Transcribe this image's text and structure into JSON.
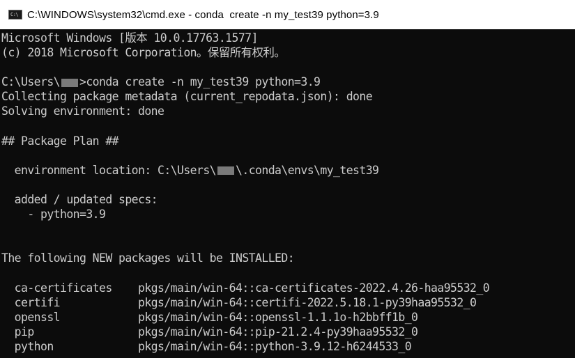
{
  "window": {
    "title": "C:\\WINDOWS\\system32\\cmd.exe - conda  create -n my_test39 python=3.9",
    "icon": "cmd-icon",
    "icon_glyph": "C:\\"
  },
  "console": {
    "lines": [
      "Microsoft Windows [版本 10.0.17763.1577]",
      "(c) 2018 Microsoft Corporation。保留所有权利。",
      "",
      {
        "before": "C:\\Users\\",
        "redacted": true,
        "after": ">conda create -n my_test39 python=3.9"
      },
      "Collecting package metadata (current_repodata.json): done",
      "Solving environment: done",
      "",
      "## Package Plan ##",
      "",
      {
        "before": "  environment location: C:\\Users\\",
        "redacted": true,
        "after": "\\.conda\\envs\\my_test39"
      },
      "",
      "  added / updated specs:",
      "    - python=3.9",
      "",
      "",
      "The following NEW packages will be INSTALLED:",
      "",
      "  ca-certificates    pkgs/main/win-64::ca-certificates-2022.4.26-haa95532_0",
      "  certifi            pkgs/main/win-64::certifi-2022.5.18.1-py39haa95532_0",
      "  openssl            pkgs/main/win-64::openssl-1.1.1o-h2bbff1b_0",
      "  pip                pkgs/main/win-64::pip-21.2.4-py39haa95532_0",
      "  python             pkgs/main/win-64::python-3.9.12-h6244533_0"
    ]
  }
}
